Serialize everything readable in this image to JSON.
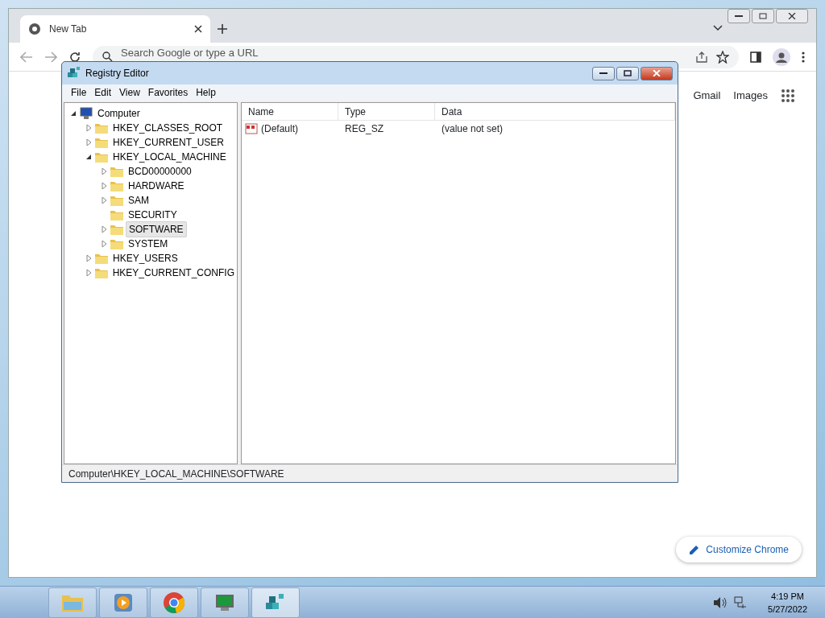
{
  "browser": {
    "tab": {
      "title": "New Tab",
      "selected": true
    },
    "omnibox": {
      "placeholder": "Search Google or type a URL"
    },
    "links": [
      "Gmail",
      "Images"
    ],
    "customize_button": "Customize Chrome"
  },
  "registry_editor": {
    "title": "Registry Editor",
    "menu": [
      "File",
      "Edit",
      "View",
      "Favorites",
      "Help"
    ],
    "tree": {
      "label": "Computer",
      "has_subkeys": true,
      "expanded": true,
      "selected": false,
      "children": [
        {
          "label": "HKEY_CLASSES_ROOT",
          "has_subkeys": true,
          "expanded": false,
          "selected": false
        },
        {
          "label": "HKEY_CURRENT_USER",
          "has_subkeys": true,
          "expanded": false,
          "selected": false
        },
        {
          "label": "HKEY_LOCAL_MACHINE",
          "has_subkeys": true,
          "expanded": true,
          "selected": false,
          "children": [
            {
              "label": "BCD00000000",
              "has_subkeys": true,
              "expanded": false,
              "selected": false
            },
            {
              "label": "HARDWARE",
              "has_subkeys": true,
              "expanded": false,
              "selected": false
            },
            {
              "label": "SAM",
              "has_subkeys": true,
              "expanded": false,
              "selected": false
            },
            {
              "label": "SECURITY",
              "has_subkeys": false,
              "selected": false
            },
            {
              "label": "SOFTWARE",
              "has_subkeys": true,
              "expanded": false,
              "selected": true
            },
            {
              "label": "SYSTEM",
              "has_subkeys": true,
              "expanded": false,
              "selected": false
            }
          ]
        },
        {
          "label": "HKEY_USERS",
          "has_subkeys": true,
          "expanded": false,
          "selected": false
        },
        {
          "label": "HKEY_CURRENT_CONFIG",
          "has_subkeys": true,
          "expanded": false,
          "selected": false
        }
      ]
    },
    "columns": [
      "Name",
      "Type",
      "Data"
    ],
    "values": [
      {
        "name": "(Default)",
        "type": "REG_SZ",
        "data": "(value not set)"
      }
    ],
    "status_bar": "Computer\\HKEY_LOCAL_MACHINE\\SOFTWARE"
  },
  "taskbar": {
    "clock_time": "4:19 PM",
    "clock_date": "5/27/2022"
  }
}
